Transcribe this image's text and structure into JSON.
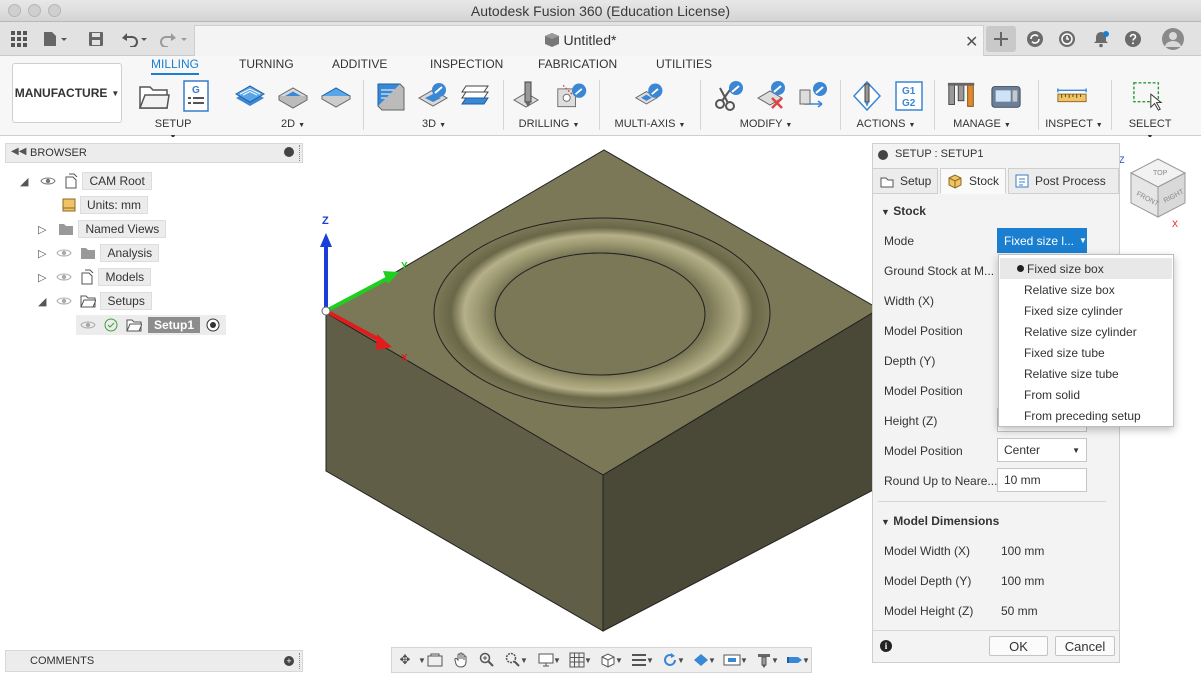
{
  "window": {
    "title": "Autodesk Fusion 360 (Education License)"
  },
  "document_tab": {
    "title": "Untitled*"
  },
  "workspace": {
    "label": "MANUFACTURE"
  },
  "ribbon": {
    "tabs": [
      {
        "label": "MILLING",
        "active": true
      },
      {
        "label": "TURNING"
      },
      {
        "label": "ADDITIVE"
      },
      {
        "label": "INSPECTION"
      },
      {
        "label": "FABRICATION"
      },
      {
        "label": "UTILITIES"
      }
    ],
    "groups": [
      {
        "label": "SETUP"
      },
      {
        "label": "2D"
      },
      {
        "label": "3D"
      },
      {
        "label": "DRILLING"
      },
      {
        "label": "MULTI-AXIS"
      },
      {
        "label": "MODIFY"
      },
      {
        "label": "ACTIONS"
      },
      {
        "label": "MANAGE"
      },
      {
        "label": "INSPECT"
      },
      {
        "label": "SELECT"
      }
    ],
    "setup_icon_text": "G",
    "actions_icon_text_1": "G1",
    "actions_icon_text_2": "G2"
  },
  "browser": {
    "title": "BROWSER",
    "items": [
      {
        "label": "CAM Root"
      },
      {
        "label": "Units: mm"
      },
      {
        "label": "Named Views"
      },
      {
        "label": "Analysis"
      },
      {
        "label": "Models"
      },
      {
        "label": "Setups"
      },
      {
        "label": "Setup1"
      }
    ]
  },
  "comments": {
    "title": "COMMENTS"
  },
  "viewport": {
    "axis_z": "Z",
    "axis_y": "Y",
    "axis_x": "X",
    "viewcube_top": "TOP",
    "viewcube_front": "FRONT",
    "viewcube_right": "RIGHT",
    "viewcube_z": "Z",
    "viewcube_x": "X"
  },
  "setup_panel": {
    "title": "SETUP : SETUP1",
    "tabs": [
      {
        "label": "Setup"
      },
      {
        "label": "Stock",
        "active": true
      },
      {
        "label": "Post Process"
      }
    ],
    "stock_section": "Stock",
    "fields": {
      "mode_label": "Mode",
      "mode_value": "Fixed size l...",
      "ground_stock_label": "Ground Stock at M...",
      "width_label": "Width (X)",
      "model_position_label_1": "Model Position",
      "depth_label": "Depth (Y)",
      "model_position_label_2": "Model Position",
      "height_label": "Height (Z)",
      "model_position_label_3": "Model Position",
      "model_position_value_3": "Center",
      "round_up_label": "Round Up to Neare...",
      "round_up_value": "10 mm"
    },
    "model_dimensions_section": "Model Dimensions",
    "model_dimensions": [
      {
        "label": "Model Width (X)",
        "value": "100 mm"
      },
      {
        "label": "Model Depth (Y)",
        "value": "100 mm"
      },
      {
        "label": "Model Height (Z)",
        "value": "50 mm"
      }
    ],
    "ok_label": "OK",
    "cancel_label": "Cancel"
  },
  "mode_dropdown": {
    "options": [
      {
        "label": "Fixed size box",
        "selected": true
      },
      {
        "label": "Relative size box"
      },
      {
        "label": "Fixed size cylinder"
      },
      {
        "label": "Relative size cylinder"
      },
      {
        "label": "Fixed size tube"
      },
      {
        "label": "Relative size tube"
      },
      {
        "label": "From solid"
      },
      {
        "label": "From preceding setup"
      }
    ]
  },
  "colors": {
    "accent": "#1a7fd1",
    "model_top": "#7b7858",
    "model_front": "#605e46",
    "model_right": "#4a4836"
  }
}
